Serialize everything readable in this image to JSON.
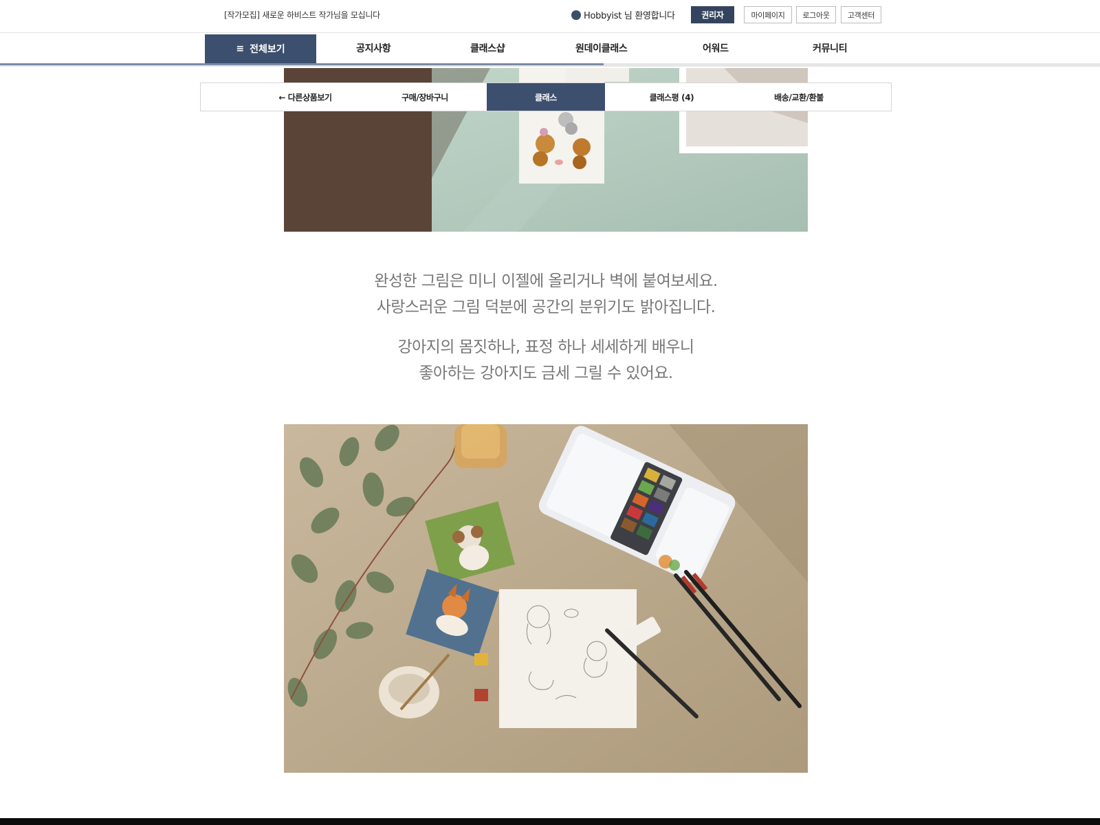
{
  "topbar": {
    "notice": "[작가모집] 새로운 하비스트 작가님을 모십니다",
    "welcome": "Hobbyist 님 환영합니다",
    "buttons": [
      "권리자",
      "마이페이지",
      "로그아웃",
      "고객센터"
    ]
  },
  "nav": {
    "all_label": "전체보기",
    "items": [
      "공지사항",
      "클래스샵",
      "원데이클래스",
      "어워드",
      "커뮤니티"
    ]
  },
  "subnav": {
    "tabs": [
      "← 다른상품보기",
      "구매/장바구니",
      "클래스",
      "클래스평 (4)",
      "배송/교환/환불"
    ],
    "active_tab": "클래스"
  },
  "content": {
    "para1": [
      "완성한 그림은 미니 이젤에 올리거나 벽에 붙여보세요.",
      "사랑스러운 그림 덕분에 공간의 분위기도 밝아집니다."
    ],
    "para2": [
      "강아지의 몸짓하나, 표정 하나 세세하게 배우니",
      "좋아하는 강아지도 금세 그릴 수 있어요."
    ]
  },
  "colors": {
    "accent": "#3c4f6e",
    "body_text": "#777777"
  }
}
